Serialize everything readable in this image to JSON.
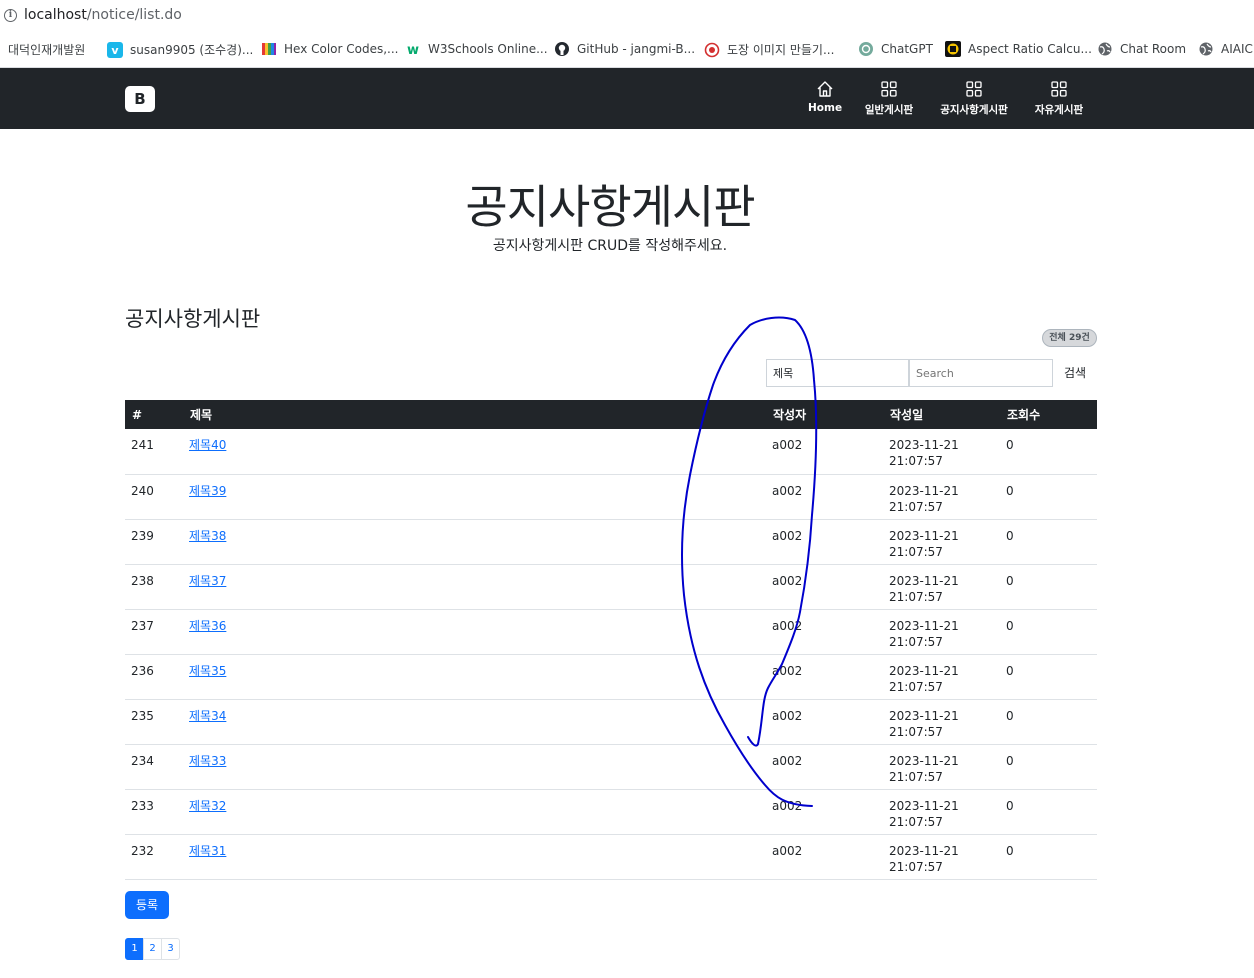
{
  "browser": {
    "url_host": "localhost",
    "url_path": "/notice/list.do",
    "bookmarks": [
      {
        "label": "대덕인재개발원",
        "icon": "none"
      },
      {
        "label": "susan9905 (조수경)...",
        "icon": "vimeo-icon",
        "color": "#1ab7ea"
      },
      {
        "label": "Hex Color Codes,...",
        "icon": "color-book-icon"
      },
      {
        "label": "W3Schools Online...",
        "icon": "w3schools-icon",
        "color": "#04aa6d"
      },
      {
        "label": "GitHub - jangmi-B...",
        "icon": "github-icon"
      },
      {
        "label": "도장 이미지 만들기...",
        "icon": "stamp-icon",
        "color": "#d32f2f"
      },
      {
        "label": "ChatGPT",
        "icon": "chatgpt-icon",
        "color": "#74aa9c"
      },
      {
        "label": "Aspect Ratio Calcu...",
        "icon": "aspect-ratio-icon",
        "color": "#f5c400"
      },
      {
        "label": "Chat Room",
        "icon": "globe-icon"
      },
      {
        "label": "AIAIC",
        "icon": "globe-icon"
      }
    ]
  },
  "navbar": {
    "brand": "B",
    "items": [
      {
        "label": "Home",
        "icon": "house-icon"
      },
      {
        "label": "일반게시판",
        "icon": "grid-icon"
      },
      {
        "label": "공지사항게시판",
        "icon": "grid-icon"
      },
      {
        "label": "자유게시판",
        "icon": "grid-icon"
      }
    ]
  },
  "hero": {
    "title": "공지사항게시판",
    "subtitle": "공지사항게시판 CRUD를 작성해주세요."
  },
  "board": {
    "section_title": "공지사항게시판",
    "total_badge": "전체 29건",
    "search": {
      "select_value": "제목",
      "placeholder": "Search",
      "button": "검색"
    },
    "columns": [
      "#",
      "제목",
      "작성자",
      "작성일",
      "조회수"
    ],
    "rows": [
      {
        "num": "241",
        "title": "제목40",
        "writer": "a002",
        "date": "2023-11-21",
        "time": "21:07:57",
        "hits": "0"
      },
      {
        "num": "240",
        "title": "제목39",
        "writer": "a002",
        "date": "2023-11-21",
        "time": "21:07:57",
        "hits": "0"
      },
      {
        "num": "239",
        "title": "제목38",
        "writer": "a002",
        "date": "2023-11-21",
        "time": "21:07:57",
        "hits": "0"
      },
      {
        "num": "238",
        "title": "제목37",
        "writer": "a002",
        "date": "2023-11-21",
        "time": "21:07:57",
        "hits": "0"
      },
      {
        "num": "237",
        "title": "제목36",
        "writer": "a002",
        "date": "2023-11-21",
        "time": "21:07:57",
        "hits": "0"
      },
      {
        "num": "236",
        "title": "제목35",
        "writer": "a002",
        "date": "2023-11-21",
        "time": "21:07:57",
        "hits": "0"
      },
      {
        "num": "235",
        "title": "제목34",
        "writer": "a002",
        "date": "2023-11-21",
        "time": "21:07:57",
        "hits": "0"
      },
      {
        "num": "234",
        "title": "제목33",
        "writer": "a002",
        "date": "2023-11-21",
        "time": "21:07:57",
        "hits": "0"
      },
      {
        "num": "233",
        "title": "제목32",
        "writer": "a002",
        "date": "2023-11-21",
        "time": "21:07:57",
        "hits": "0"
      },
      {
        "num": "232",
        "title": "제목31",
        "writer": "a002",
        "date": "2023-11-21",
        "time": "21:07:57",
        "hits": "0"
      }
    ],
    "register_button": "등록",
    "pages": [
      "1",
      "2",
      "3"
    ],
    "current_page": "1"
  },
  "colors": {
    "navbar_bg": "#212529",
    "primary": "#0d6efd",
    "annotation_stroke": "#0000cc"
  }
}
